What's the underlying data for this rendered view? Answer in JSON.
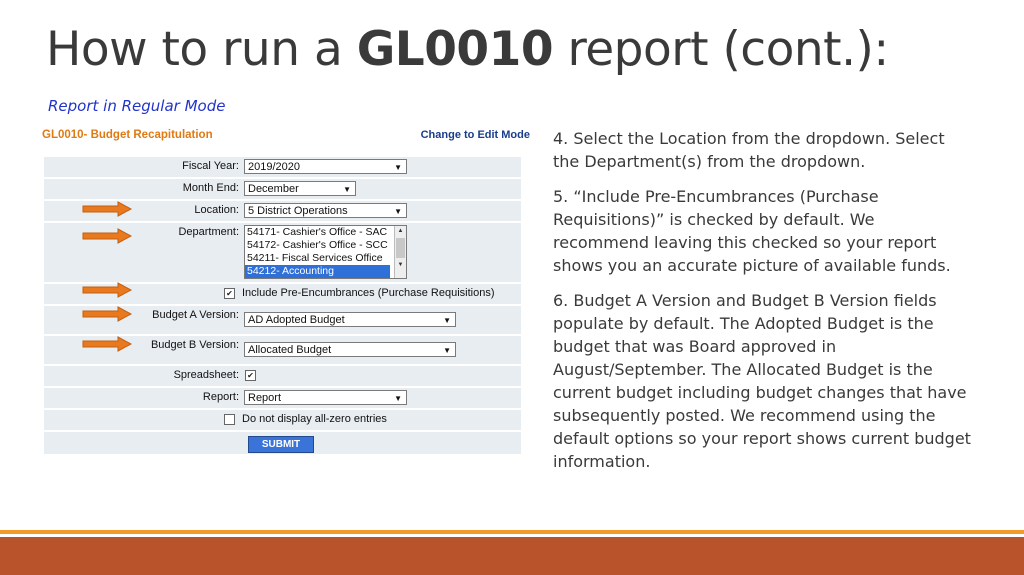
{
  "slide": {
    "title_prefix": "How to run a ",
    "title_bold": "GL0010",
    "title_suffix": " report (cont.):",
    "subtitle": "Report in Regular Mode"
  },
  "form": {
    "title": "GL0010- Budget Recapitulation",
    "edit_link": "Change to Edit Mode",
    "fiscal_year": {
      "label": "Fiscal Year:",
      "value": "2019/2020"
    },
    "month_end": {
      "label": "Month End:",
      "value": "December"
    },
    "location": {
      "label": "Location:",
      "value": "5 District Operations"
    },
    "department": {
      "label": "Department:",
      "options": [
        "54171- Cashier's Office - SAC",
        "54172- Cashier's Office - SCC",
        "54211- Fiscal Services Office",
        "54212- Accounting"
      ],
      "selected_index": 3
    },
    "pre_encumbrances": {
      "label": "Include Pre-Encumbrances (Purchase Requisitions)",
      "checked": true
    },
    "budget_a": {
      "label": "Budget A Version:",
      "value": "AD Adopted Budget"
    },
    "budget_b": {
      "label": "Budget B Version:",
      "value": "Allocated Budget"
    },
    "spreadsheet": {
      "label": "Spreadsheet:",
      "checked": true
    },
    "report": {
      "label": "Report:",
      "value": "Report"
    },
    "zero_entries": {
      "label": "Do not display all-zero entries",
      "checked": false
    },
    "submit_label": "SUBMIT"
  },
  "steps": [
    "4. Select the Location from the dropdown. Select the Department(s) from the dropdown.",
    "5. “Include Pre-Encumbrances (Purchase Requisitions)” is checked by default. We recommend leaving this checked so your report shows you an accurate picture of available funds.",
    "6. Budget A Version and Budget B Version fields populate by default.  The Adopted Budget is the budget that was Board approved in August/September.  The Allocated Budget is the current budget including budget changes that have subsequently posted.  We recommend using the default options so your report shows current budget information."
  ],
  "icons": {
    "check": "✔",
    "caret": "▼",
    "arrow": "orange-right-arrow"
  },
  "colors": {
    "accent_orange": "#f29b2b",
    "footer": "#b9532b",
    "arrow": "#e8791f",
    "link_blue": "#2233cc"
  }
}
